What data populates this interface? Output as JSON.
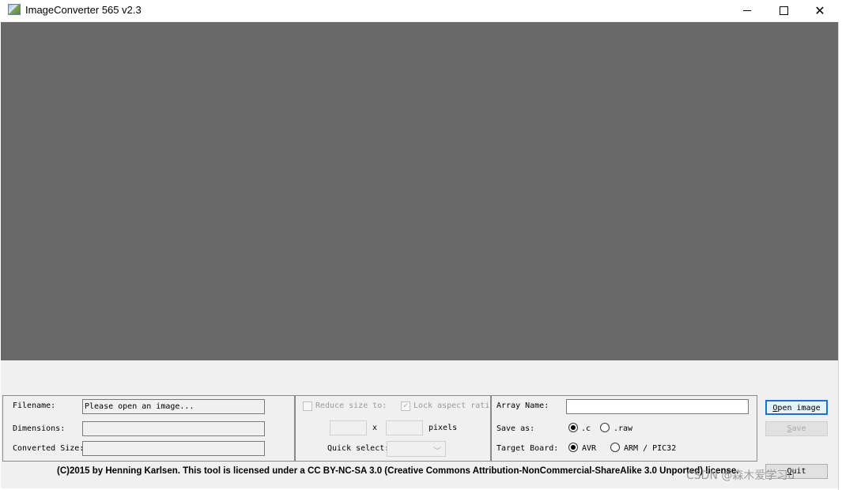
{
  "window": {
    "title": "ImageConverter 565 v2.3",
    "min_glyph": "",
    "close_glyph": "✕"
  },
  "file_panel": {
    "filename_label": "Filename:",
    "filename_value": "Please open an image...",
    "dimensions_label": "Dimensions:",
    "dimensions_value": "",
    "converted_label": "Converted Size:",
    "converted_value": ""
  },
  "resize_panel": {
    "reduce_label": "Reduce size to:",
    "reduce_checked": false,
    "lock_label": "Lock aspect ratio",
    "lock_checked": true,
    "width_value": "",
    "x_label": "x",
    "height_value": "",
    "pixels_label": "pixels",
    "quick_select_label": "Quick select:",
    "quick_select_value": ""
  },
  "output_panel": {
    "array_name_label": "Array Name:",
    "array_name_value": "",
    "save_as_label": "Save as:",
    "save_as_options": [
      ".c",
      ".raw"
    ],
    "save_as_selected": ".c",
    "target_board_label": "Target Board:",
    "target_board_options": [
      "AVR",
      "ARM / PIC32"
    ],
    "target_board_selected": "AVR"
  },
  "buttons": {
    "open_image": {
      "accel": "O",
      "rest": "pen image"
    },
    "save": {
      "accel": "S",
      "rest": "ave"
    },
    "quit": {
      "accel": "Q",
      "rest": "uit"
    }
  },
  "footer": {
    "license": "(C)2015 by Henning Karlsen. This tool is licensed under a CC BY-NC-SA 3.0 (Creative Commons Attribution-NonCommercial-ShareAlike 3.0 Unported) license.",
    "watermark": "CSDN @森木爱学习u"
  },
  "colors": {
    "canvas": "#696969",
    "window_bg": "#f0f0f0",
    "focus_blue": "#1f6fd1"
  }
}
